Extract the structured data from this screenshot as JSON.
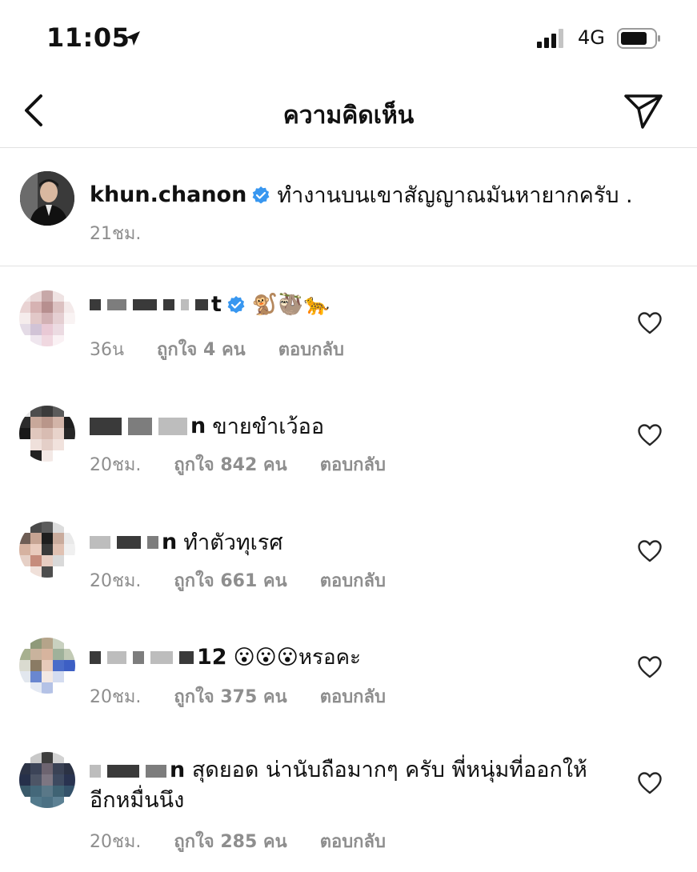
{
  "status_bar": {
    "time": "11:05",
    "network": "4G"
  },
  "header": {
    "title": "ความคิดเห็น"
  },
  "caption": {
    "username": "khun.chanon",
    "text": "ทำงานบนเขาสัญญาณมันหายากครับ .",
    "time": "21ชม."
  },
  "comments": [
    {
      "username_visible": "t",
      "text": "🐒🦥🐆",
      "time": "36น",
      "likes": "ถูกใจ 4 คน",
      "reply": "ตอบกลับ"
    },
    {
      "username_visible": "n",
      "text": "ขายขำเว้ออ",
      "time": "20ชม.",
      "likes": "ถูกใจ 842 คน",
      "reply": "ตอบกลับ"
    },
    {
      "username_visible": "n",
      "text": "ทำตัวทุเรศ",
      "time": "20ชม.",
      "likes": "ถูกใจ 661 คน",
      "reply": "ตอบกลับ"
    },
    {
      "username_visible": "12",
      "text": "😮😮😮หรอคะ",
      "time": "20ชม.",
      "likes": "ถูกใจ 375 คน",
      "reply": "ตอบกลับ"
    },
    {
      "username_visible": "n",
      "text": "สุดยอด น่านับถือมากๆ ครับ พี่หนุ่มที่ออกให้อีกหมื่นนึง",
      "time": "20ชม.",
      "likes": "ถูกใจ 285 คน",
      "reply": "ตอบกลับ"
    }
  ],
  "colors": {
    "verified": "#3897f0",
    "meta_text": "#8e8e8e",
    "divider": "#e2e2e2"
  }
}
